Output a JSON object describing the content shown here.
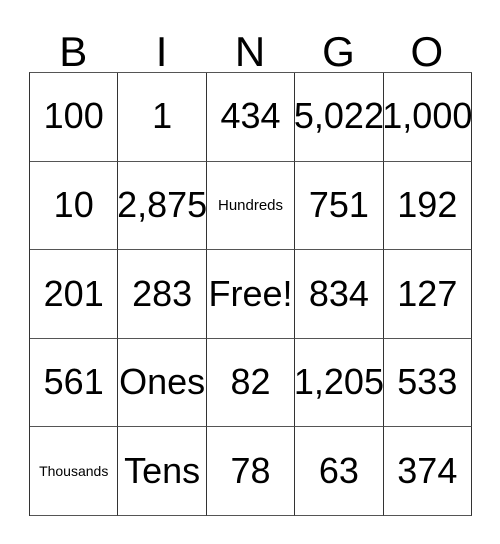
{
  "card": {
    "title": "BINGO",
    "headers": [
      "B",
      "I",
      "N",
      "G",
      "O"
    ],
    "rows": [
      [
        {
          "text": "100",
          "size": "normal"
        },
        {
          "text": "1",
          "size": "normal"
        },
        {
          "text": "434",
          "size": "normal"
        },
        {
          "text": "5,022",
          "size": "normal"
        },
        {
          "text": "1,000",
          "size": "normal"
        }
      ],
      [
        {
          "text": "10",
          "size": "normal"
        },
        {
          "text": "2,875",
          "size": "normal"
        },
        {
          "text": "Hundreds",
          "size": "small"
        },
        {
          "text": "751",
          "size": "normal"
        },
        {
          "text": "192",
          "size": "normal"
        }
      ],
      [
        {
          "text": "201",
          "size": "normal"
        },
        {
          "text": "283",
          "size": "normal"
        },
        {
          "text": "Free!",
          "size": "normal"
        },
        {
          "text": "834",
          "size": "normal"
        },
        {
          "text": "127",
          "size": "normal"
        }
      ],
      [
        {
          "text": "561",
          "size": "normal"
        },
        {
          "text": "Ones",
          "size": "normal"
        },
        {
          "text": "82",
          "size": "normal"
        },
        {
          "text": "1,205",
          "size": "normal"
        },
        {
          "text": "533",
          "size": "normal"
        }
      ],
      [
        {
          "text": "Thousands",
          "size": "xsmall"
        },
        {
          "text": "Tens",
          "size": "normal"
        },
        {
          "text": "78",
          "size": "normal"
        },
        {
          "text": "63",
          "size": "normal"
        },
        {
          "text": "374",
          "size": "normal"
        }
      ]
    ],
    "free_space_label": "Free!",
    "colors": {
      "background": "#ffffff",
      "text": "#000000",
      "border": "#333333"
    }
  }
}
